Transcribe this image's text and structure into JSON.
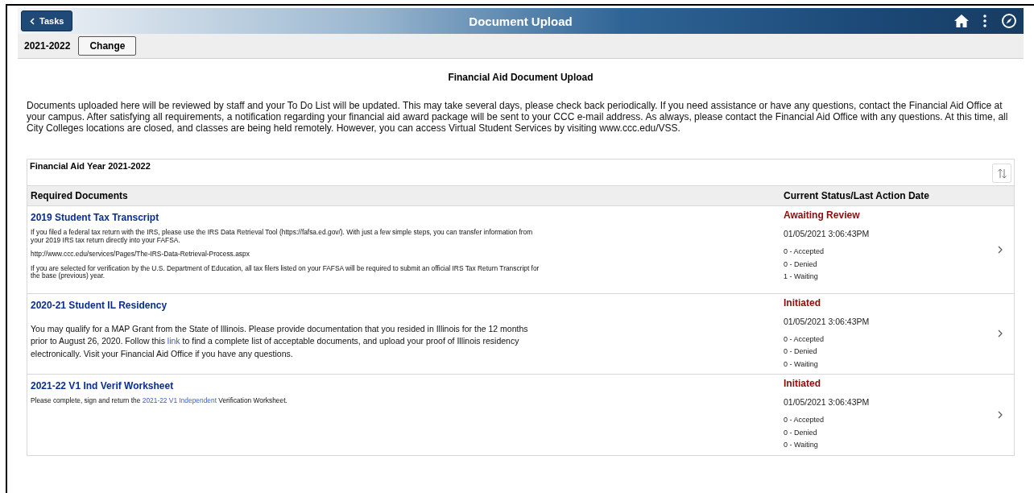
{
  "header": {
    "back_label": "Tasks",
    "title": "Document Upload"
  },
  "sub_bar": {
    "aid_year": "2021-2022",
    "change_label": "Change"
  },
  "page_heading": "Financial Aid Document Upload",
  "intro": "Documents uploaded here will be reviewed by staff and your To Do List will be updated. This may take several days, please check back periodically. If you need assistance or have any questions, contact the Financial Aid Office at your campus. After satisfying all requirements, a notification regarding your financial aid award package will be sent to your CCC e-mail address. As always, please contact the Financial Aid Office with any questions. At this time, all City Colleges locations are closed, and classes are being held remotely. However, you can access Virtual Student Services by visiting www.ccc.edu/VSS.",
  "grid": {
    "title": "Financial Aid Year 2021-2022",
    "columns": [
      "Required Documents",
      "Current Status/Last Action Date"
    ],
    "rows": [
      {
        "title": "2019 Student Tax Transcript",
        "kind": "fine",
        "paragraphs": [
          [
            {
              "kind": "text",
              "text": "If you filed a federal tax return with the IRS, please use the IRS Data Retrieval Tool (https://fafsa.ed.gov/). With just a few simple steps, you can transfer information from your 2019 IRS tax return directly into your FAFSA."
            }
          ],
          [
            {
              "kind": "text",
              "text": "http://www.ccc.edu/services/Pages/The-IRS-Data-Retrieval-Process.aspx"
            }
          ],
          [
            {
              "kind": "text",
              "text": "If you are selected for verification by the U.S. Department of Education, all tax filers listed on your FAFSA will be required to submit an official IRS Tax Return Transcript for the base (previous) year."
            }
          ]
        ],
        "status": "Awaiting Review",
        "date": "01/05/2021  3:06:43PM",
        "counts": [
          "0 - Accepted",
          "0 - Denied",
          "1 - Waiting"
        ]
      },
      {
        "title": "2020-21 Student IL Residency",
        "kind": "regular",
        "paragraphs": [
          [
            {
              "kind": "text",
              "text": "You may qualify for a MAP Grant from the State of Illinois. Please provide documentation that you resided in Illinois for the 12 months prior to August 26, 2020. Follow this "
            },
            {
              "kind": "link",
              "text": "link"
            },
            {
              "kind": "text",
              "text": " to find a complete list of acceptable documents, and upload your proof of Illinois residency electronically.  Visit your Financial Aid Office if you have any questions."
            }
          ]
        ],
        "status": "Initiated",
        "date": "01/05/2021  3:06:43PM",
        "counts": [
          "0 - Accepted",
          "0 - Denied",
          "0 - Waiting"
        ]
      },
      {
        "title": "2021-22 V1 Ind Verif Worksheet",
        "kind": "fine",
        "paragraphs": [
          [
            {
              "kind": "text",
              "text": "Please complete, sign and return the "
            },
            {
              "kind": "link",
              "text": "2021-22 V1 Independent"
            },
            {
              "kind": "text",
              "text": " Verification Worksheet."
            }
          ]
        ],
        "status": "Initiated",
        "date": "01/05/2021  3:06:43PM",
        "counts": [
          "0 - Accepted",
          "0 - Denied",
          "0 - Waiting"
        ]
      }
    ]
  }
}
